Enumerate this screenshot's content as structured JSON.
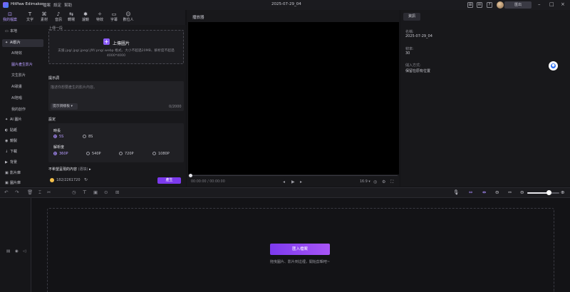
{
  "app": {
    "name": "HitPaw Edimakor",
    "menus": [
      "檔案",
      "設定",
      "幫助"
    ],
    "window_title": "2025-07-29_04",
    "export_label": "匯出",
    "title_icons": [
      "⊞",
      "✉",
      "?",
      "🔒"
    ]
  },
  "toolbar": {
    "tools": [
      {
        "icon": "⊡",
        "label": "我的檔案",
        "active": true
      },
      {
        "icon": "T",
        "label": "文字"
      },
      {
        "icon": "⌘",
        "label": "素材"
      },
      {
        "icon": "♪",
        "label": "音訊"
      },
      {
        "icon": "⇆",
        "label": "轉場"
      },
      {
        "icon": "✱",
        "label": "濾鏡"
      },
      {
        "icon": "✧",
        "label": "特效"
      },
      {
        "icon": "▭",
        "label": "字幕"
      },
      {
        "icon": "☺",
        "label": "數位人"
      }
    ]
  },
  "sidebar": {
    "items": [
      {
        "icon": "▭",
        "label": "本地"
      },
      {
        "icon": "✦",
        "label": "AI影片",
        "active": true
      }
    ],
    "sub_items": [
      {
        "label": "AI特效"
      },
      {
        "label": "圖片產生影片",
        "active": true
      },
      {
        "label": "文生影片"
      },
      {
        "label": "AI歌畫"
      },
      {
        "label": "AI陪唱"
      },
      {
        "label": "我的創作"
      }
    ],
    "items2": [
      {
        "icon": "✦",
        "label": "AI 圖片"
      },
      {
        "icon": "◐",
        "label": "貼紙"
      },
      {
        "icon": "◉",
        "label": "鏡製"
      },
      {
        "icon": "↓",
        "label": "下載"
      },
      {
        "icon": "▶",
        "label": "背景"
      },
      {
        "icon": "▣",
        "label": "影片庫"
      },
      {
        "icon": "▣",
        "label": "圖片庫"
      }
    ]
  },
  "panel": {
    "upload_label": "上傳一段",
    "upload_button": "上傳圖片",
    "upload_hint": "支援.jpg/.jpg/.jpeg/.jfif/.png/.webp 格式、大小不超過20MB、解析度不超過 4000*4000",
    "prompt_label": "提示詞",
    "prompt_placeholder": "描述你想要產生的影片內容。",
    "prompt_template": "提示詞樣板 ▾",
    "counter": "0/2000",
    "settings_label": "設定",
    "duration_label": "時長",
    "durations": [
      {
        "label": "5S",
        "on": true
      },
      {
        "label": "8S"
      }
    ],
    "resolution_label": "解析度",
    "resolutions": [
      {
        "label": "360P",
        "on": true
      },
      {
        "label": "540P"
      },
      {
        "label": "720P"
      },
      {
        "label": "1080P"
      }
    ],
    "negative_label": "不希望呈現的內容",
    "negative_sub": "(選填)",
    "credits": "182/2261720",
    "generate": "產生"
  },
  "player": {
    "title": "播放器",
    "time_current": "00:00:00",
    "time_total": "00:00:00",
    "ratio": "16:9 ▾",
    "progress": 0
  },
  "info": {
    "tab": "資訊",
    "name_label": "名稱:",
    "name_value": "2025-07-29_04",
    "fps_label": "幀率:",
    "fps_value": "30",
    "save_label": "儲入方式:",
    "save_value": "保留在原有位置"
  },
  "timeline": {
    "import_button": "匯入檔案",
    "hint": "拖曳圖片、影片到這裡，開始剪輯吧~",
    "zoom": 0.67
  }
}
